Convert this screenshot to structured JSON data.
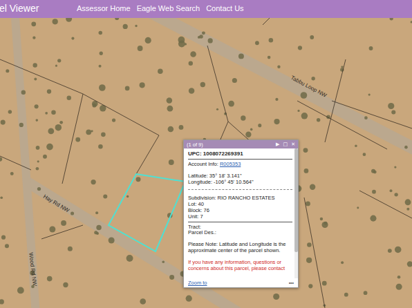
{
  "header": {
    "title": "el Viewer",
    "nav": [
      "Assessor Home",
      "Eagle Web Search",
      "Contact Us"
    ]
  },
  "map": {
    "road_labels": [
      {
        "text": "Tabbu Loop NW"
      },
      {
        "text": "Hay Rd NW"
      },
      {
        "text": "Wood Rd NW"
      }
    ]
  },
  "popup": {
    "counter": "(1 of 9)",
    "controls": [
      "▶",
      "□",
      "✕"
    ],
    "title": "UPC: 1008072269391",
    "account_label": "Account Info:",
    "account_link": "R005353",
    "coordinates": [
      "Latitude: 35° 18' 3.141\"",
      "Longitude: -106° 45' 10.564\""
    ],
    "attributes": [
      {
        "label": "Subdivision:",
        "value": "RIO RANCHO ESTATES"
      },
      {
        "label": "Lot:",
        "value": "40"
      },
      {
        "label": "Block:",
        "value": "76"
      },
      {
        "label": "Unit:",
        "value": "7"
      }
    ],
    "extra": [
      "Tract:",
      "Parcel Des.:"
    ],
    "note": "Please Note: Latitude and Longitude is the approximate center of the parcel shown.",
    "contact": "If you have any information, questions or concerns about this parcel, please contact",
    "zoom": "Zoom to",
    "menu": "•••"
  }
}
